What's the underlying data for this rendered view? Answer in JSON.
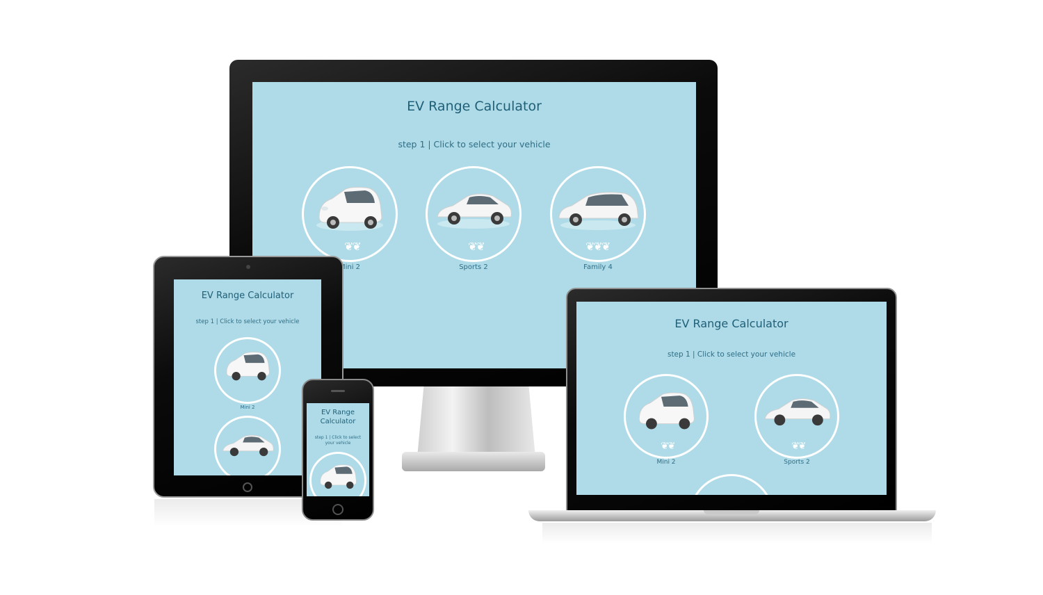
{
  "app": {
    "title": "EV Range Calculator",
    "title_phone_line1": "EV Range",
    "title_phone_line2": "Calculator",
    "step": "step 1 | Click to select your vehicle",
    "step_phone_line1": "step 1 | Click to select",
    "step_phone_line2": "your vehicle"
  },
  "vehicles": [
    {
      "label": "Mini 2",
      "seats": 2,
      "type": "mini"
    },
    {
      "label": "Sports 2",
      "seats": 2,
      "type": "sports"
    },
    {
      "label": "Family 4",
      "seats": 4,
      "type": "family"
    }
  ],
  "colors": {
    "screen_bg": "#aedbe7",
    "title_text": "#1f5f78",
    "circle_border": "#ffffff",
    "bezel": "#000000"
  },
  "icons": [
    "person-icon",
    "car-image"
  ]
}
